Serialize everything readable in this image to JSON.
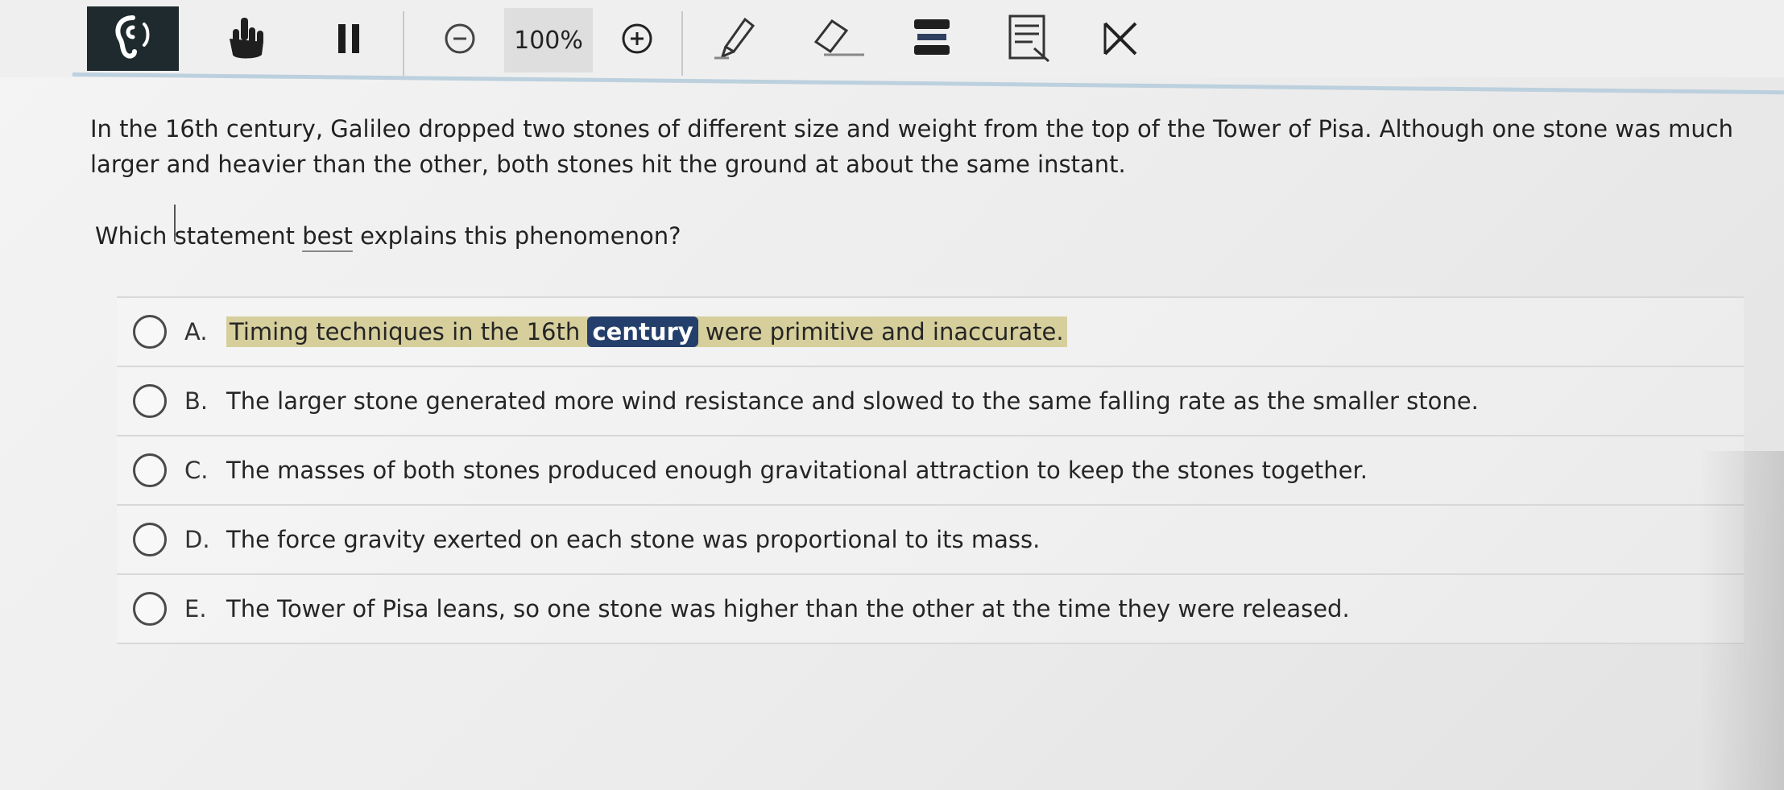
{
  "toolbar": {
    "zoom_label": "100%",
    "icons": [
      "audio-icon",
      "hand-pointer-icon",
      "pause-icon",
      "zoom-out-icon",
      "zoom-in-icon",
      "pen-icon",
      "eraser-icon",
      "highlighter-icon",
      "notes-icon",
      "eliminate-choice-icon"
    ],
    "accent_color": "#1f2a2e"
  },
  "question": {
    "stem": "In the 16th century, Galileo dropped two stones of different size and weight from the top of the Tower of Pisa. Although one stone was much larger and heavier than the other, both stones hit the ground at about the same instant.",
    "prompt_before": "Which statement ",
    "prompt_emphasis": "best",
    "prompt_after": " explains this phenomenon?"
  },
  "options": [
    {
      "letter": "A.",
      "text_before": "Timing techniques in the 16th ",
      "text_highlight": "century",
      "text_after": " were primitive and inaccurate."
    },
    {
      "letter": "B.",
      "text": "The larger stone generated more wind resistance and slowed to the same falling rate as the smaller stone."
    },
    {
      "letter": "C.",
      "text": "The masses of both stones produced enough gravitational attraction to keep the stones together."
    },
    {
      "letter": "D.",
      "text": "The force gravity exerted on each stone was proportional to its mass."
    },
    {
      "letter": "E.",
      "text": "The Tower of Pisa leans, so one stone was higher than the other at the time they were released."
    }
  ],
  "colors": {
    "highlight_yellow": "#d6cf9c",
    "highlight_dark": "#243f6b"
  }
}
